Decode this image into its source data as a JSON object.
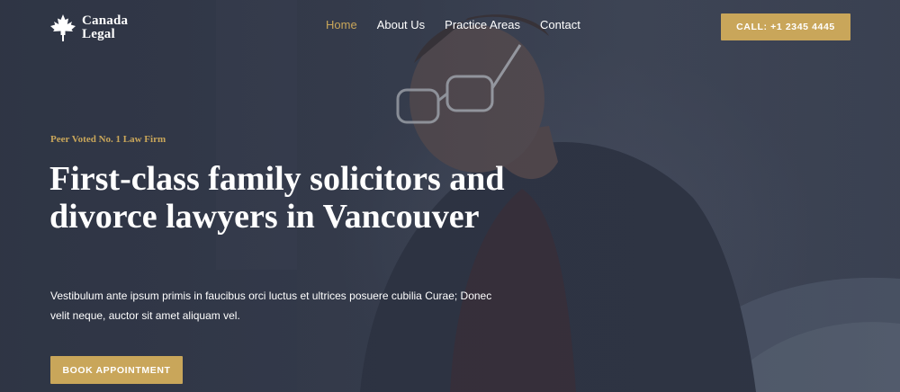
{
  "brand": {
    "name_line1": "Canada",
    "name_line2": "Legal",
    "icon": "maple-leaf-icon"
  },
  "nav": {
    "items": [
      {
        "label": "Home",
        "active": true
      },
      {
        "label": "About Us",
        "active": false
      },
      {
        "label": "Practice Areas",
        "active": false
      },
      {
        "label": "Contact",
        "active": false
      }
    ]
  },
  "header": {
    "call_label": "CALL: +1 2345 4445"
  },
  "hero": {
    "eyebrow": "Peer Voted No. 1 Law Firm",
    "headline": "First-class family solicitors and divorce lawyers in Vancouver",
    "description": "Vestibulum ante ipsum primis in faucibus orci luctus et ultrices posuere cubilia Curae; Donec velit neque, auctor sit amet aliquam vel.",
    "cta_label": "BOOK APPOINTMENT"
  },
  "colors": {
    "accent": "#c9a65a",
    "overlay": "#3a4152",
    "text": "#ffffff"
  }
}
